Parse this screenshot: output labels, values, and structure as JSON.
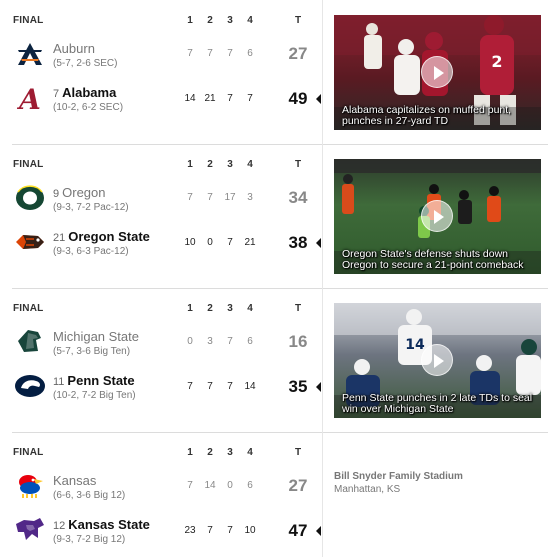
{
  "games": [
    {
      "status": "FINAL",
      "quarter_headers": [
        "1",
        "2",
        "3",
        "4"
      ],
      "total_header": "T",
      "away": {
        "rank": "",
        "name": "Auburn",
        "record": "(5-7, 2-6 SEC)",
        "quarters": [
          "7",
          "7",
          "7",
          "6"
        ],
        "total": "27",
        "logo": "auburn-logo",
        "winner": false
      },
      "home": {
        "rank": "7",
        "name": "Alabama",
        "record": "(10-2, 6-2 SEC)",
        "quarters": [
          "14",
          "21",
          "7",
          "7"
        ],
        "total": "49",
        "logo": "alabama-logo",
        "winner": true
      },
      "video": {
        "caption": "Alabama capitalizes on muffed punt, punches in 27-yard TD"
      }
    },
    {
      "status": "FINAL",
      "quarter_headers": [
        "1",
        "2",
        "3",
        "4"
      ],
      "total_header": "T",
      "away": {
        "rank": "9",
        "name": "Oregon",
        "record": "(9-3, 7-2 Pac-12)",
        "quarters": [
          "7",
          "7",
          "17",
          "3"
        ],
        "total": "34",
        "logo": "oregon-logo",
        "winner": false
      },
      "home": {
        "rank": "21",
        "name": "Oregon State",
        "record": "(9-3, 6-3 Pac-12)",
        "quarters": [
          "10",
          "0",
          "7",
          "21"
        ],
        "total": "38",
        "logo": "oregon-state-logo",
        "winner": true
      },
      "video": {
        "caption": "Oregon State's defense shuts down Oregon to secure a 21-point comeback"
      }
    },
    {
      "status": "FINAL",
      "quarter_headers": [
        "1",
        "2",
        "3",
        "4"
      ],
      "total_header": "T",
      "away": {
        "rank": "",
        "name": "Michigan State",
        "record": "(5-7, 3-6 Big Ten)",
        "quarters": [
          "0",
          "3",
          "7",
          "6"
        ],
        "total": "16",
        "logo": "michigan-state-logo",
        "winner": false
      },
      "home": {
        "rank": "11",
        "name": "Penn State",
        "record": "(10-2, 7-2 Big Ten)",
        "quarters": [
          "7",
          "7",
          "7",
          "14"
        ],
        "total": "35",
        "logo": "penn-state-logo",
        "winner": true
      },
      "video": {
        "caption": "Penn State punches in 2 late TDs to seal win over Michigan State"
      }
    },
    {
      "status": "FINAL",
      "quarter_headers": [
        "1",
        "2",
        "3",
        "4"
      ],
      "total_header": "T",
      "away": {
        "rank": "",
        "name": "Kansas",
        "record": "(6-6, 3-6 Big 12)",
        "quarters": [
          "7",
          "14",
          "0",
          "6"
        ],
        "total": "27",
        "logo": "kansas-logo",
        "winner": false
      },
      "home": {
        "rank": "12",
        "name": "Kansas State",
        "record": "(9-3, 7-2 Big 12)",
        "quarters": [
          "23",
          "7",
          "7",
          "10"
        ],
        "total": "47",
        "logo": "kansas-state-logo",
        "winner": true
      },
      "venue": {
        "name": "Bill Snyder Family Stadium",
        "location": "Manhattan, KS"
      }
    }
  ],
  "colors": {
    "auburn_navy": "#0c2340",
    "auburn_orange": "#e87722",
    "alabama_crimson": "#9e1b32",
    "oregon_green": "#154733",
    "oregon_yellow": "#fee123",
    "oregon_state_orange": "#dc4405",
    "michigan_state_green": "#18453b",
    "penn_state_navy": "#041e42",
    "kansas_blue": "#0051ba",
    "kansas_red": "#e8000d",
    "kansas_yellow": "#ffc82d",
    "kansas_state_purple": "#512888"
  }
}
